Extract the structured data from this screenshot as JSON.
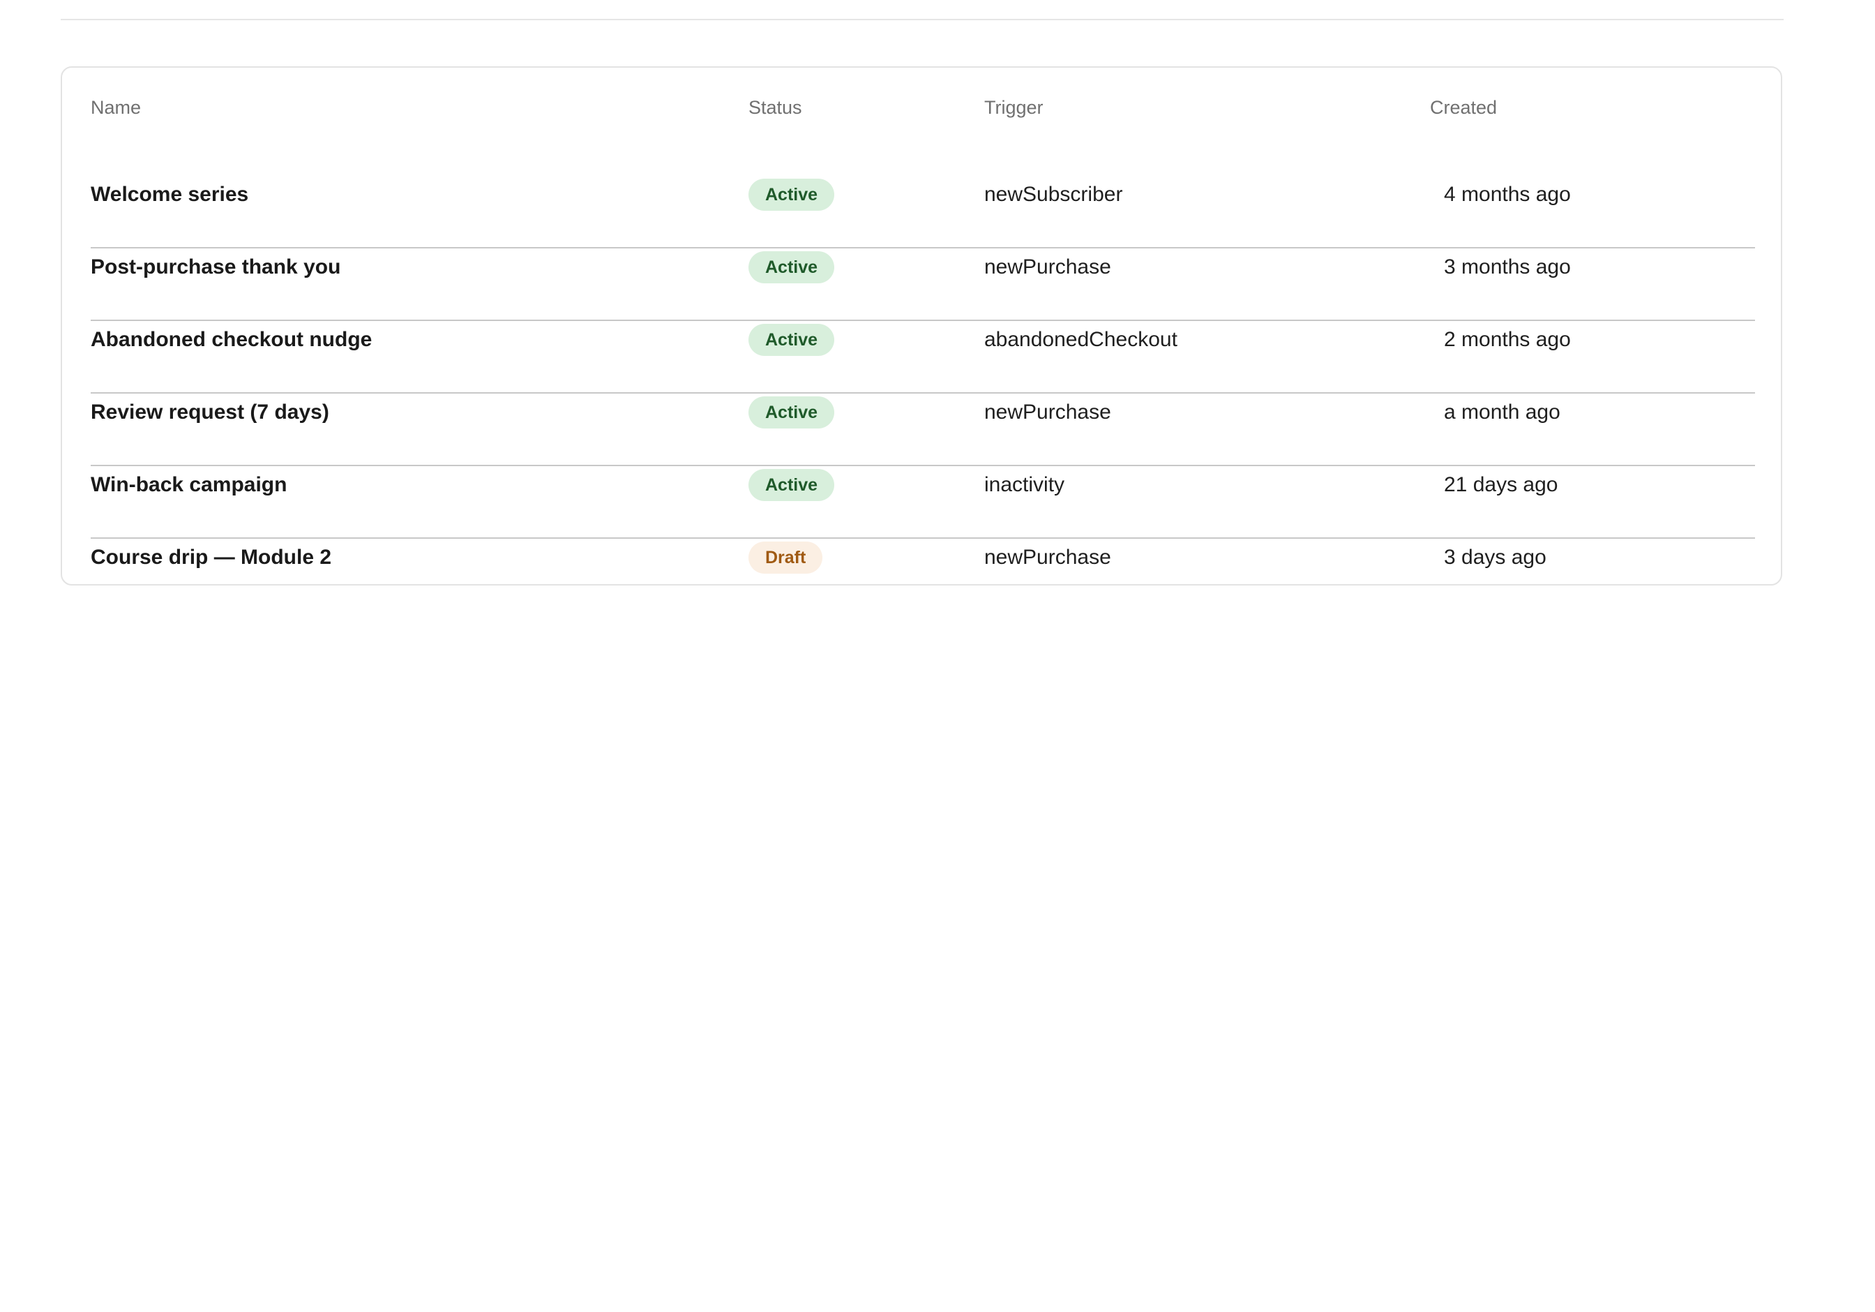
{
  "colors": {
    "active_badge_bg": "#d8efdc",
    "active_badge_text": "#1f5a2a",
    "draft_badge_bg": "#fbefe3",
    "draft_badge_text": "#a05a12"
  },
  "table": {
    "headers": {
      "name": "Name",
      "status": "Status",
      "trigger": "Trigger",
      "created": "Created"
    },
    "rows": [
      {
        "name": "Welcome series",
        "status": "Active",
        "trigger": "newSubscriber",
        "created": "4 months ago"
      },
      {
        "name": "Post-purchase thank you",
        "status": "Active",
        "trigger": "newPurchase",
        "created": "3 months ago"
      },
      {
        "name": "Abandoned checkout nudge",
        "status": "Active",
        "trigger": "abandonedCheckout",
        "created": "2 months ago"
      },
      {
        "name": "Review request (7 days)",
        "status": "Active",
        "trigger": "newPurchase",
        "created": "a month ago"
      },
      {
        "name": "Win-back campaign",
        "status": "Active",
        "trigger": "inactivity",
        "created": "21 days ago"
      },
      {
        "name": "Course drip — Module 2",
        "status": "Draft",
        "trigger": "newPurchase",
        "created": "3 days ago"
      }
    ]
  }
}
